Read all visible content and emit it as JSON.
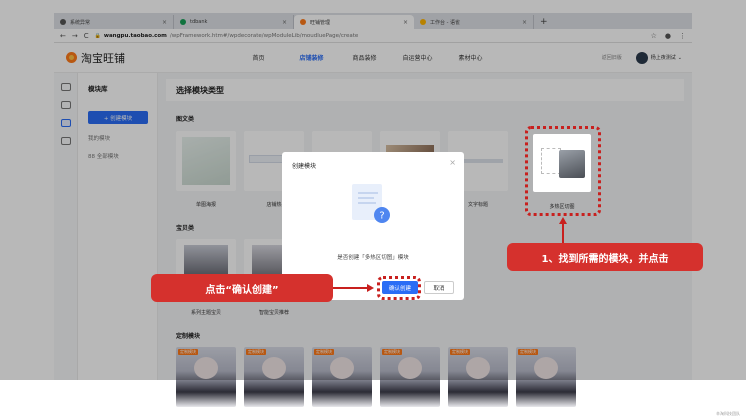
{
  "browser": {
    "tabs": [
      {
        "title": "系统异常",
        "icon_color": "#555555"
      },
      {
        "title": "tdbank",
        "icon_color": "#18a058"
      },
      {
        "title": "旺铺管理",
        "icon_color": "#ff7a1a",
        "active": true
      },
      {
        "title": "工作台 - 语雀",
        "icon_color": "#ffb400"
      }
    ],
    "new_tab": "+",
    "close_glyph": "×",
    "url_host": "wangpu.taobao.com",
    "url_path": "/wpFramework.htm#/wpdecorate/wpModuleLib/moudluePage/create",
    "nav_back": "←",
    "nav_forward": "→",
    "nav_reload": "C",
    "lock": "🔒",
    "star": "☆",
    "menu": "⋮"
  },
  "header": {
    "logo_text": "淘宝旺铺",
    "nav": [
      "首页",
      "店铺装修",
      "商品装修",
      "自运营中心",
      "素材中心"
    ],
    "active_nav": "店铺装修",
    "back_old": "返回旧版",
    "user_name": "杨上夜测试"
  },
  "sidebar": {
    "title": "模块库",
    "create_button": "+ 创建模块",
    "my_modules": "我的模块",
    "all_modules": "88 全部模块"
  },
  "main": {
    "title": "选择模块类型",
    "sections": [
      "图文类",
      "宝贝类",
      "定制模块"
    ],
    "captions_row1": [
      "单图海报",
      "店铺热",
      "",
      "",
      "文字标题",
      "多热区切图"
    ],
    "captions_row2": [
      "系列主题宝贝",
      "智能宝贝推荐"
    ],
    "badge": "定制模块"
  },
  "dialog": {
    "title": "创建模块",
    "close": "×",
    "message": "是否创建「多热区切图」模块",
    "ok": "确认创建",
    "cancel": "取消",
    "question_mark": "?"
  },
  "callouts": {
    "left": "点击“确认创建”",
    "right": "1、找到所需的模块，并点击"
  },
  "colors": {
    "accent": "#2a6df5",
    "callout": "#d5312d",
    "brand": "#ff7a1a"
  },
  "watermark": "辛淘科技团队"
}
